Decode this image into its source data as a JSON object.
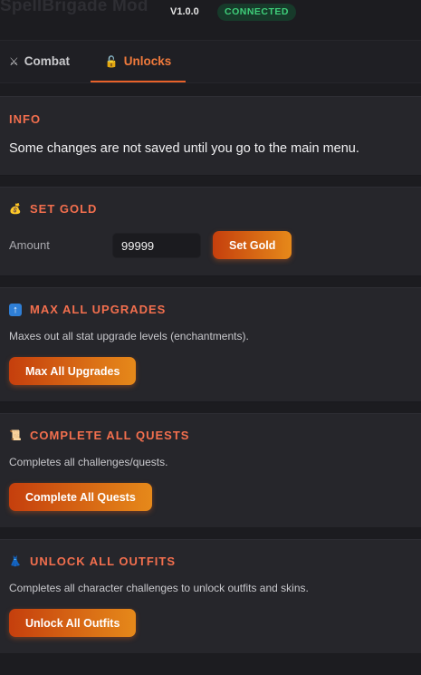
{
  "header": {
    "title": "SpellBrigade Mod",
    "version": "V1.0.0",
    "status": "CONNECTED"
  },
  "tabs": [
    {
      "label": "Combat",
      "icon": "crossed-swords-icon",
      "active": false
    },
    {
      "label": "Unlocks",
      "icon": "unlocked-padlock-icon",
      "active": true
    }
  ],
  "info": {
    "title": "INFO",
    "text": "Some changes are not saved until you go to the main menu."
  },
  "set_gold": {
    "title": "SET GOLD",
    "icon": "money-bag-icon",
    "amount_label": "Amount",
    "amount_value": "99999",
    "button_label": "Set Gold"
  },
  "max_upgrades": {
    "title": "MAX ALL UPGRADES",
    "icon": "up-arrow-icon",
    "description": "Maxes out all stat upgrade levels (enchantments).",
    "button_label": "Max All Upgrades"
  },
  "complete_quests": {
    "title": "COMPLETE ALL QUESTS",
    "icon": "scroll-icon",
    "description": "Completes all challenges/quests.",
    "button_label": "Complete All Quests"
  },
  "unlock_outfits": {
    "title": "UNLOCK ALL OUTFITS",
    "icon": "dress-icon",
    "description": "Completes all character challenges to unlock outfits and skins.",
    "button_label": "Unlock All Outfits"
  },
  "colors": {
    "accent": "#f07a3c",
    "title_orange": "#f36f4e",
    "status_green": "#3fcf7a",
    "background": "#1c1c20",
    "card": "#26262b"
  }
}
